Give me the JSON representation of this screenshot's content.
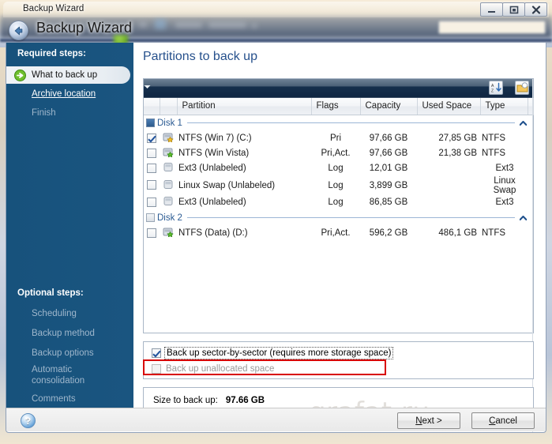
{
  "window": {
    "title": "Backup Wizard",
    "app_title": "Backup Wizard",
    "buttons": {
      "minimize": "minimize-icon",
      "maximize": "maximize-icon",
      "close": "close-icon"
    },
    "back_icon": "back-arrow-icon"
  },
  "sidebar": {
    "required_heading": "Required steps:",
    "optional_heading": "Optional steps:",
    "required_items": [
      {
        "label": "What to back up",
        "state": "active",
        "icon": "green-arrow-icon"
      },
      {
        "label": "Archive location",
        "state": "link"
      },
      {
        "label": "Finish",
        "state": "dim"
      }
    ],
    "optional_items": [
      {
        "label": "Scheduling",
        "state": "dim"
      },
      {
        "label": "Backup method",
        "state": "dim"
      },
      {
        "label": "Backup options",
        "state": "dim"
      },
      {
        "label": "Automatic consolidation",
        "state": "dim"
      },
      {
        "label": "Comments",
        "state": "dim"
      }
    ]
  },
  "main": {
    "page_title": "Partitions to back up",
    "toolbar": {
      "sort_icon": "sort-az-icon",
      "dropdown_icon": "chevron-down-icon",
      "properties_icon": "folder-properties-icon"
    },
    "table": {
      "columns": [
        "Partition",
        "Flags",
        "Capacity",
        "Used Space",
        "Type"
      ],
      "groups": [
        {
          "name": "Disk 1",
          "icon": "disk-icon-filled",
          "collapse_icon": "chevron-up-icon",
          "rows": [
            {
              "checked": true,
              "icon": "drive-star-icon",
              "name": "NTFS (Win 7) (C:)",
              "flags": "Pri",
              "capacity": "97,66 GB",
              "used": "27,85 GB",
              "type": "NTFS"
            },
            {
              "checked": false,
              "icon": "drive-green-icon",
              "name": "NTFS (Win Vista)",
              "flags": "Pri,Act.",
              "capacity": "97,66 GB",
              "used": "21,38 GB",
              "type": "NTFS"
            },
            {
              "checked": false,
              "icon": "drive-plain-icon",
              "name": "Ext3 (Unlabeled)",
              "flags": "Log",
              "capacity": "12,01 GB",
              "used": "",
              "type": "Ext3"
            },
            {
              "checked": false,
              "icon": "drive-plain-icon",
              "name": "Linux Swap (Unlabeled)",
              "flags": "Log",
              "capacity": "3,899 GB",
              "used": "",
              "type": "Linux Swap"
            },
            {
              "checked": false,
              "icon": "drive-plain-icon",
              "name": "Ext3 (Unlabeled)",
              "flags": "Log",
              "capacity": "86,85 GB",
              "used": "",
              "type": "Ext3"
            }
          ]
        },
        {
          "name": "Disk 2",
          "icon": "disk-icon-empty",
          "collapse_icon": "chevron-up-icon",
          "rows": [
            {
              "checked": false,
              "icon": "drive-green-icon",
              "name": "NTFS (Data) (D:)",
              "flags": "Pri,Act.",
              "capacity": "596,2 GB",
              "used": "486,1 GB",
              "type": "NTFS"
            }
          ]
        }
      ]
    },
    "options": {
      "sector_by_sector": {
        "label": "Back up sector-by-sector (requires more storage space)",
        "checked": true,
        "enabled": true,
        "highlighted": true
      },
      "unallocated": {
        "label": "Back up unallocated space",
        "checked": false,
        "enabled": false
      }
    },
    "size_summary": {
      "label": "Size to back up:",
      "value": "97.66 GB"
    },
    "watermark": "grafat.ru"
  },
  "footer": {
    "help_icon": "help-icon",
    "help_glyph": "?",
    "next_label_prefix": "N",
    "next_label_rest": "ext >",
    "cancel_label_prefix": "C",
    "cancel_label_rest": "ancel"
  },
  "colors": {
    "sidebar_bg": "#19537d",
    "title_blue": "#26508c",
    "group_blue": "#2b5b93",
    "highlight_red": "#d80000"
  }
}
